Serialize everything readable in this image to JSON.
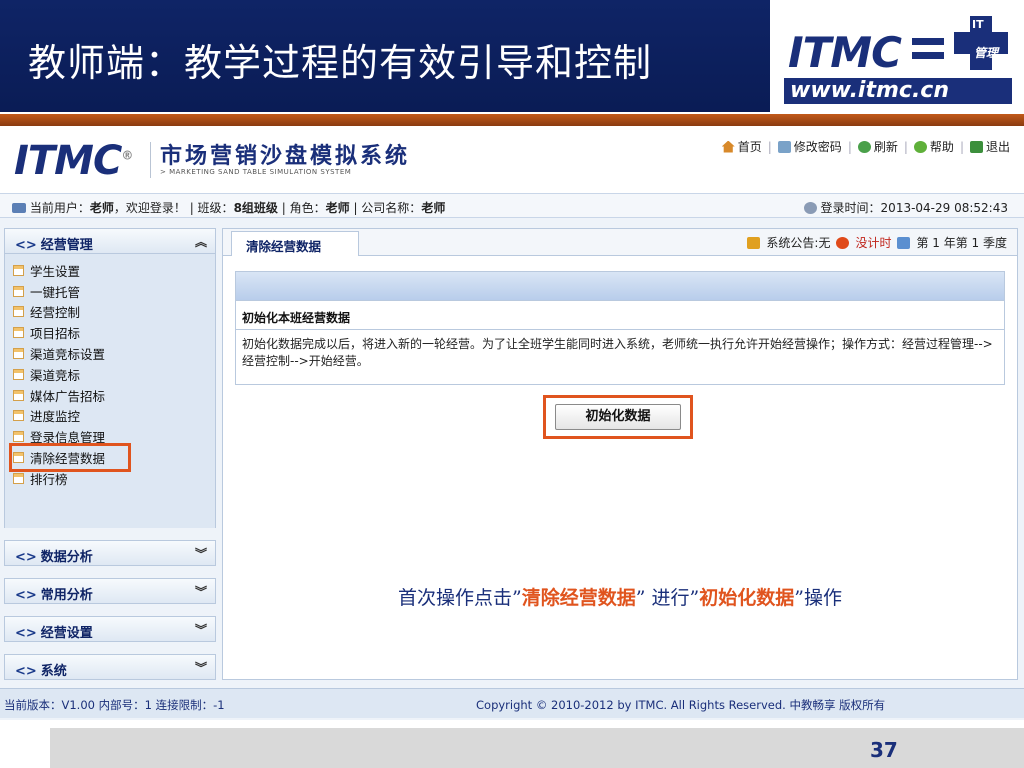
{
  "slide": {
    "title": "教师端：教学过程的有效引导和控制",
    "brand_logo": "ITMC",
    "brand_cross_top": "IT",
    "brand_cross_bottom": "管理",
    "brand_url": "www.itmc.cn",
    "page_number": "37"
  },
  "app": {
    "logo": "ITMC",
    "logo_mark": "®",
    "name": "市场营销沙盘模拟系统",
    "subtitle": "> MARKETING SAND TABLE SIMULATION SYSTEM",
    "nav": [
      {
        "label": "首页",
        "icon": "home-icon",
        "color": "#d8892a"
      },
      {
        "label": "修改密码",
        "icon": "key-icon",
        "color": "#7aa2c8"
      },
      {
        "label": "刷新",
        "icon": "refresh-icon",
        "color": "#4aa04a"
      },
      {
        "label": "帮助",
        "icon": "help-icon",
        "color": "#5fb03a"
      },
      {
        "label": "退出",
        "icon": "exit-icon",
        "color": "#3c8f3c"
      }
    ],
    "user_bar": {
      "current_user_label": "当前用户：",
      "current_user": "老师",
      "welcome": "，欢迎登录！",
      "class_label": "班级：",
      "class_value": "8组班级",
      "role_label": "角色：",
      "role_value": "老师",
      "company_label": "公司名称：",
      "company_value": "老师",
      "login_time_label": "登录时间：",
      "login_time": "2013-04-29 08:52:43"
    }
  },
  "sidebar": {
    "sections": [
      {
        "title": "经营管理",
        "arrow": "︽"
      },
      {
        "title": "数据分析",
        "arrow": "︾"
      },
      {
        "title": "常用分析",
        "arrow": "︾"
      },
      {
        "title": "经营设置",
        "arrow": "︾"
      },
      {
        "title": "系统",
        "arrow": "︾"
      }
    ],
    "items": [
      "学生设置",
      "一键托管",
      "经营控制",
      "项目招标",
      "渠道竞标设置",
      "渠道竞标",
      "媒体广告招标",
      "进度监控",
      "登录信息管理",
      "清除经营数据",
      "排行榜"
    ]
  },
  "content": {
    "tab": "清除经营数据",
    "announcement": "系统公告:无",
    "timer": "没计时",
    "period": "第 1 年第 1 季度",
    "panel_title": "初始化本班经营数据",
    "panel_text": "初始化数据完成以后，将进入新的一轮经营。为了让全班学生能同时进入系统，老师统一执行允许开始经营操作；操作方式：经营过程管理-->经营控制-->开始经营。",
    "init_button": "初始化数据",
    "instruction": {
      "p1": "首次操作点击”",
      "h1": "清除经营数据",
      "p2": "” 进行”",
      "h2": "初始化数据",
      "p3": "”操作"
    }
  },
  "footer": {
    "left": "当前版本：V1.00 内部号：1 连接限制：-1",
    "copyright": "Copyright © 2010-2012 by ITMC. All Rights Reserved. 中教畅享 版权所有"
  },
  "colors": {
    "navy": "#0f2466",
    "highlight": "#e0541e"
  }
}
